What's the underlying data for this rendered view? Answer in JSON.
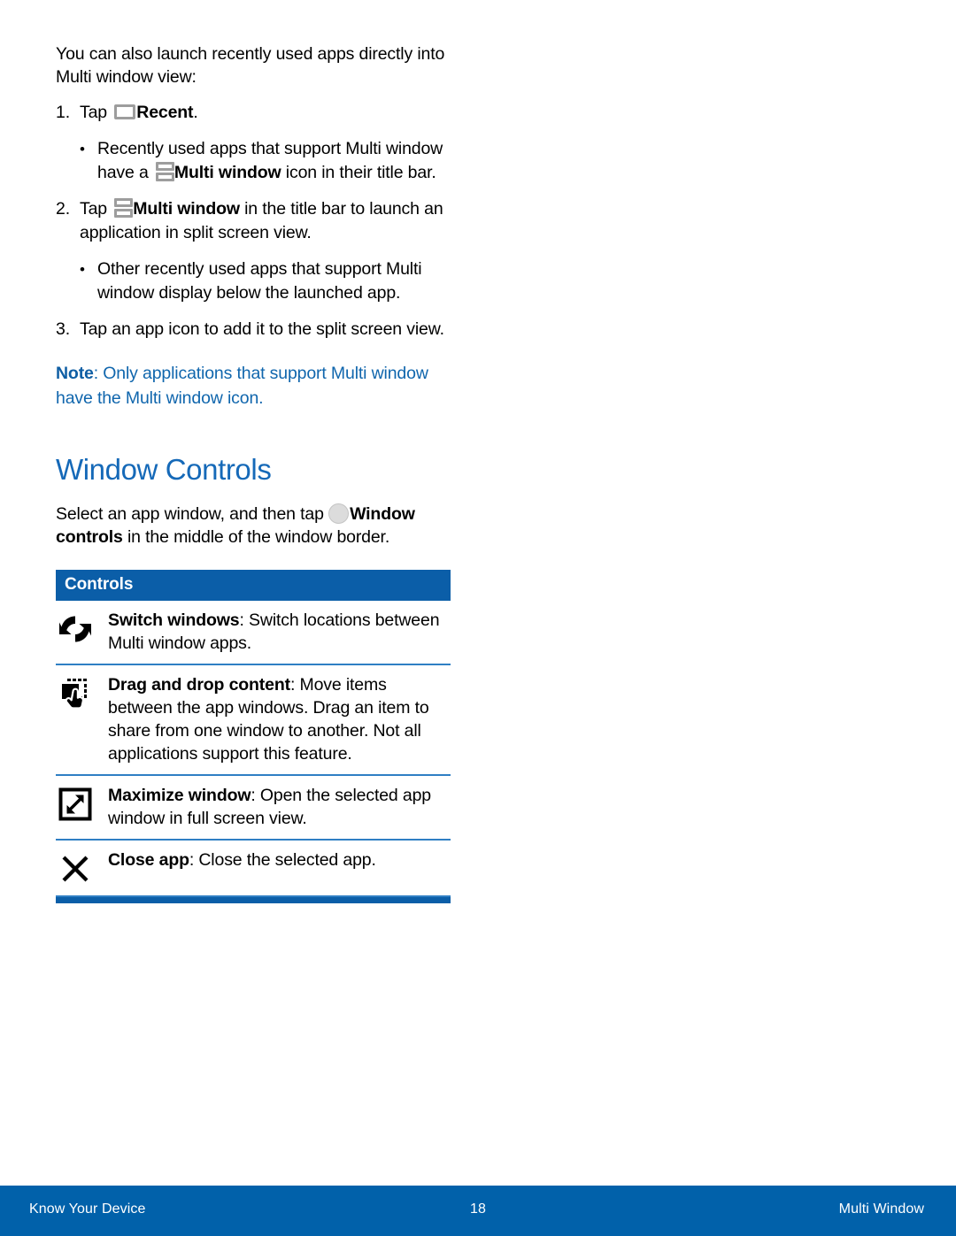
{
  "intro": {
    "paragraph": "You can also launch recently used apps directly into Multi window view:"
  },
  "steps": [
    {
      "number": "1.",
      "pre": "Tap ",
      "icon": "recent-icon",
      "bold": "Recent",
      "post": "."
    },
    {
      "number": "2.",
      "pre": "Tap ",
      "icon": "multi-window-icon",
      "bold": "Multi window",
      "post": " in the title bar to launch an application in split screen view."
    },
    {
      "number": "3.",
      "pre": "Tap an app icon to add it to the split screen view.",
      "icon": "",
      "bold": "",
      "post": ""
    }
  ],
  "bullets": [
    {
      "pre": "Recently used apps that support Multi window have a ",
      "icon": "multi-window-icon",
      "bold": "Multi window",
      "post": " icon in their title bar."
    },
    {
      "pre": "Other recently used apps that support Multi window display below the launched app.",
      "icon": "",
      "bold": "",
      "post": ""
    }
  ],
  "note": {
    "label": "Note",
    "text": ": Only applications that support Multi window have the Multi window icon."
  },
  "section": {
    "heading": "Window Controls",
    "lead_pre": "Select an app window, and then tap ",
    "lead_icon": "window-controls-circle-icon",
    "lead_bold": "Window controls",
    "lead_post": " in the middle of the window border."
  },
  "controls_table": {
    "header": "Controls",
    "rows": [
      {
        "icon": "switch-windows-icon",
        "bold": "Switch windows",
        "text": ": Switch locations between Multi window apps."
      },
      {
        "icon": "drag-and-drop-icon",
        "bold": "Drag and drop content",
        "text": ": Move items between the app windows. Drag an item to share from one window to another. Not all applications support this feature."
      },
      {
        "icon": "maximize-window-icon",
        "bold": "Maximize window",
        "text": ": Open the selected app window in full screen view."
      },
      {
        "icon": "close-app-icon",
        "bold": "Close app",
        "text": ": Close the selected app."
      }
    ]
  },
  "footer": {
    "left": "Know Your Device",
    "page_number": "18",
    "right": "Multi Window"
  },
  "colors": {
    "heading_blue": "#1569b8",
    "table_header_blue": "#0b5ea8",
    "note_blue": "#1066ad",
    "footer_blue": "#0161aa",
    "rule_blue": "#2f7fc4"
  }
}
